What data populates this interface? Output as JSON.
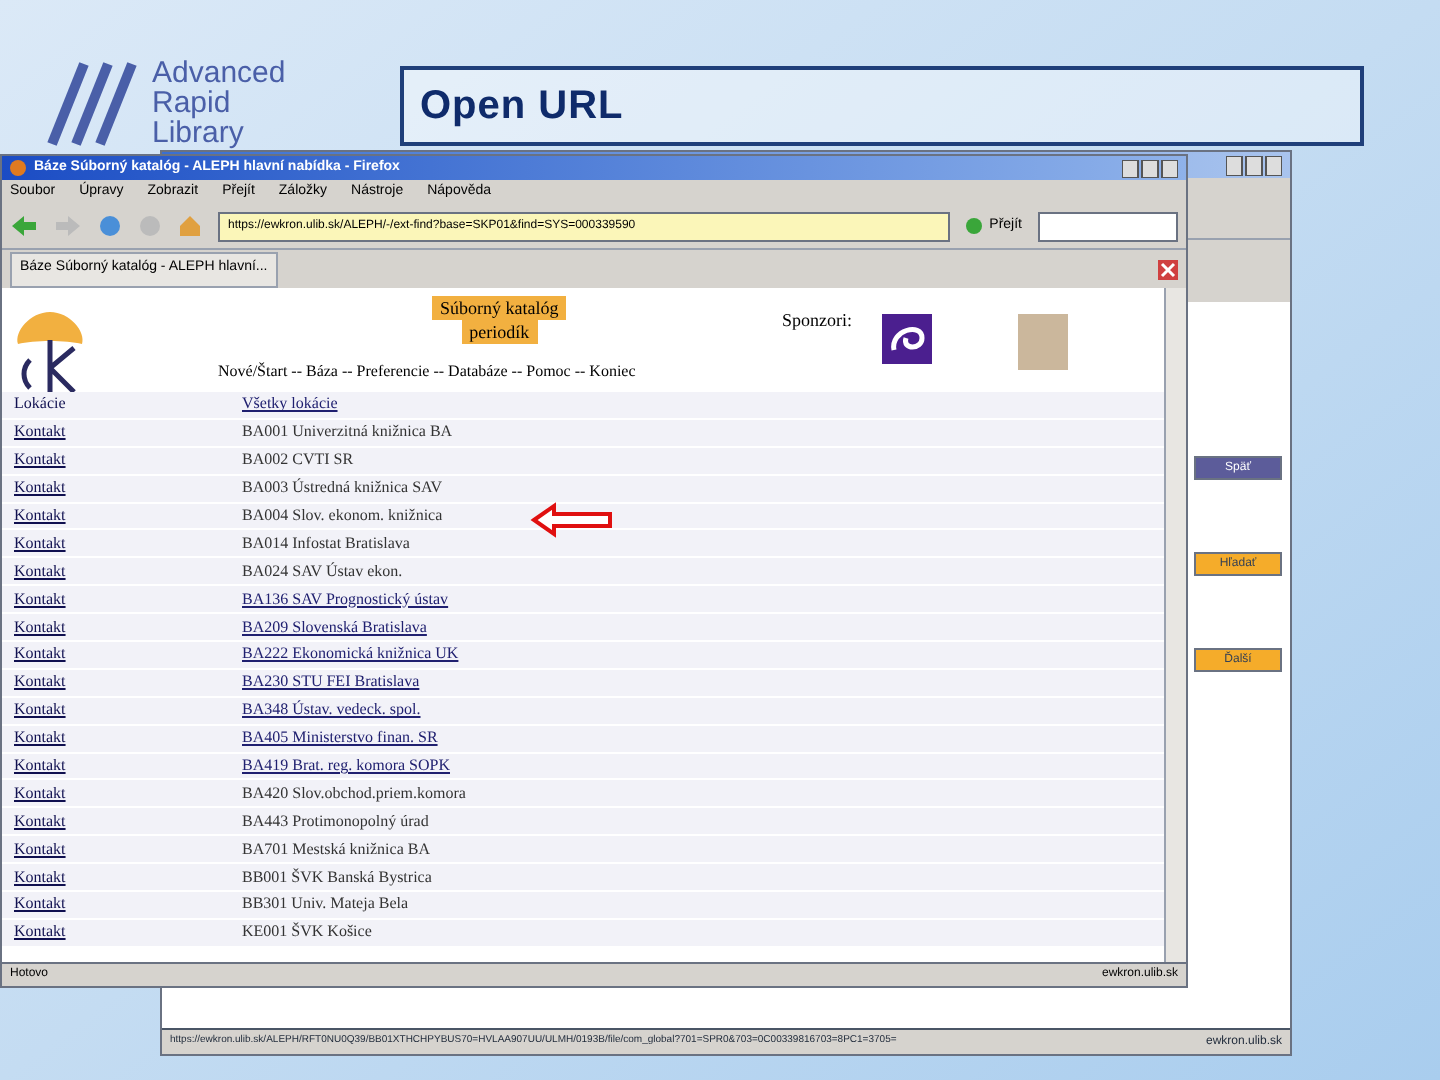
{
  "slide": {
    "logo": [
      "Advanced",
      "Rapid",
      "Library"
    ],
    "title": "Open URL"
  },
  "back_window": {
    "url": "https://ewkron.ulib.sk/ALEPH/RFT0NU0Q39/BB01XTHCHPYBUS70=HVLAA907UU/ULMH/0193B/file/com_global?701=SPR0&703=0C00339816703=8PC1=3705=",
    "site": "ewkron.ulib.sk",
    "buttons": [
      {
        "label": "Späť",
        "kind": "nav"
      },
      {
        "label": "Hľadať",
        "kind": "action"
      },
      {
        "label": "Ďalší",
        "kind": "action"
      }
    ]
  },
  "window": {
    "title": "Báze Súborný katalóg - ALEPH hlavní nabídka - Firefox",
    "menu": [
      "Soubor",
      "Úpravy",
      "Zobrazit",
      "Přejít",
      "Záložky",
      "Nástroje",
      "Nápověda"
    ],
    "url": "https://ewkron.ulib.sk/ALEPH/-/ext-find?base=SKP01&find=SYS=000339590",
    "go": "Přejít",
    "tab": "Báze Súborný katalóg - ALEPH hlavní...",
    "page": {
      "catalog": [
        "Súborný katalóg",
        "periodík"
      ],
      "nav": "Nové/Štart -- Báza -- Preferencie -- Databáze -- Pomoc -- Koniec",
      "sponsors": "Sponzori:",
      "rows": [
        {
          "left": "Lokácie",
          "left_link": false,
          "right": "Všetky lokácie",
          "right_link": true
        },
        {
          "left": "Kontakt",
          "left_link": true,
          "right": "BA001 Univerzitná knižnica BA",
          "right_link": false
        },
        {
          "left": "Kontakt",
          "left_link": true,
          "right": "BA002 CVTI SR",
          "right_link": false
        },
        {
          "left": "Kontakt",
          "left_link": true,
          "right": "BA003 Ústredná knižnica SAV",
          "right_link": false
        },
        {
          "left": "Kontakt",
          "left_link": true,
          "right": "BA004 Slov. ekonom. knižnica",
          "right_link": false
        },
        {
          "left": "Kontakt",
          "left_link": true,
          "right": "BA014 Infostat Bratislava",
          "right_link": false
        },
        {
          "left": "Kontakt",
          "left_link": true,
          "right": "BA024 SAV Ústav ekon.",
          "right_link": false
        },
        {
          "left": "Kontakt",
          "left_link": true,
          "right": "BA136 SAV Prognostický ústav",
          "right_link": true
        },
        {
          "left": "Kontakt",
          "left_link": true,
          "right": "BA209 Slovenská Bratislava",
          "right_link": true
        },
        {
          "left": "Kontakt",
          "left_link": true,
          "right": "BA222 Ekonomická knižnica UK",
          "right_link": true
        },
        {
          "left": "Kontakt",
          "left_link": true,
          "right": "BA230 STU FEI Bratislava",
          "right_link": true
        },
        {
          "left": "Kontakt",
          "left_link": true,
          "right": "BA348 Ústav. vedeck. spol.",
          "right_link": true
        },
        {
          "left": "Kontakt",
          "left_link": true,
          "right": "BA405 Ministerstvo finan. SR",
          "right_link": true
        },
        {
          "left": "Kontakt",
          "left_link": true,
          "right": "BA419 Brat. reg. komora SOPK",
          "right_link": true
        },
        {
          "left": "Kontakt",
          "left_link": true,
          "right": "BA420 Slov.obchod.priem.komora",
          "right_link": false
        },
        {
          "left": "Kontakt",
          "left_link": true,
          "right": "BA443 Protimonopolný úrad",
          "right_link": false
        },
        {
          "left": "Kontakt",
          "left_link": true,
          "right": "BA701 Mestská knižnica BA",
          "right_link": false
        },
        {
          "left": "Kontakt",
          "left_link": true,
          "right": "BB001 ŠVK Banská Bystrica",
          "right_link": false
        },
        {
          "left": "Kontakt",
          "left_link": true,
          "right": "BB301 Univ. Mateja Bela",
          "right_link": false
        },
        {
          "left": "Kontakt",
          "left_link": true,
          "right": "KE001 ŠVK Košice",
          "right_link": false
        }
      ]
    },
    "status": "Hotovo",
    "site": "ewkron.ulib.sk"
  }
}
